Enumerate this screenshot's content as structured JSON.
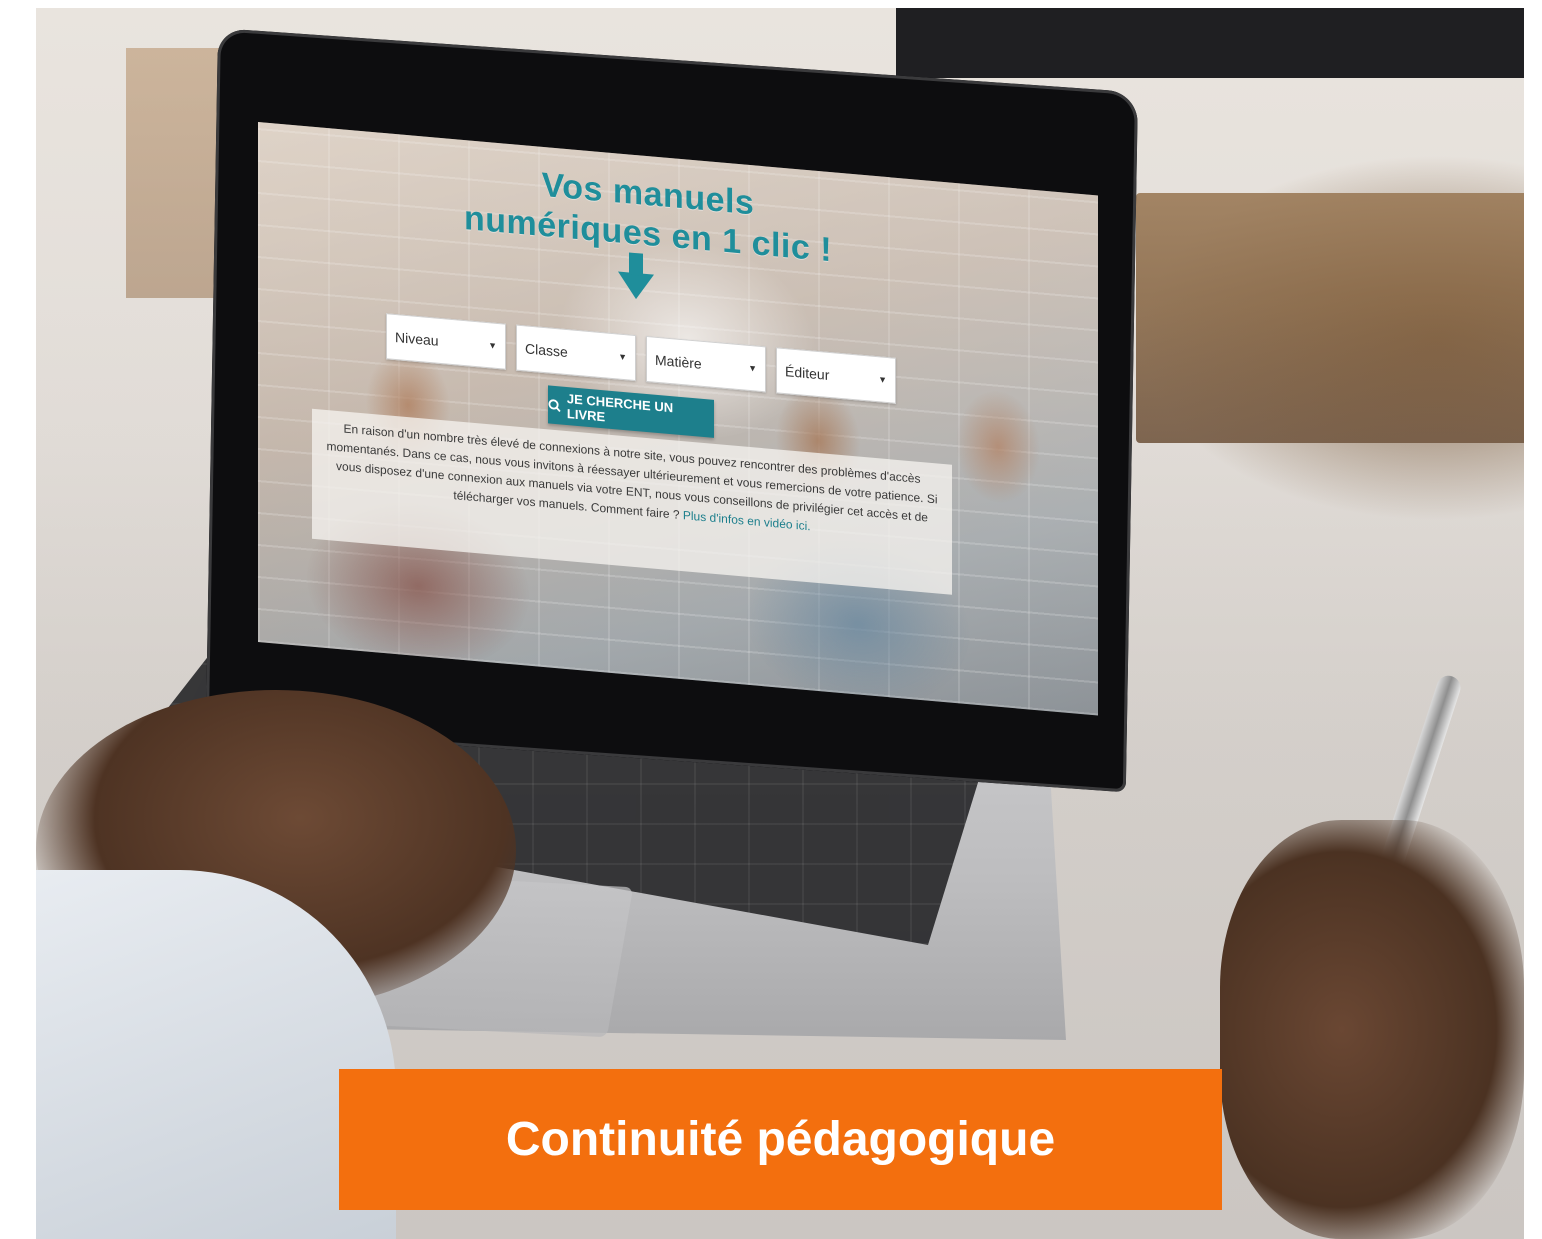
{
  "screen": {
    "headline_line1": "Vos manuels",
    "headline_line2": "numériques en 1 clic !",
    "selects": [
      {
        "label": "Niveau"
      },
      {
        "label": "Classe"
      },
      {
        "label": "Matière"
      },
      {
        "label": "Éditeur"
      }
    ],
    "search_button": "JE CHERCHE UN LIVRE",
    "notice": {
      "text": "En raison d'un nombre très élevé de connexions à notre site, vous pouvez rencontrer des problèmes d'accès momentanés. Dans ce cas, nous vous invitons à réessayer ultérieurement et vous remercions de votre patience. Si vous disposez d'une connexion aux manuels via votre ENT, nous vous conseillons de privilégier cet accès et de télécharger vos manuels. Comment faire ?",
      "link": "Plus d'infos en vidéo ici."
    }
  },
  "banner": {
    "text": "Continuité pédagogique"
  },
  "colors": {
    "accent_teal": "#1f8e9b",
    "button_teal": "#1d7f8c",
    "banner_orange": "#f36f0e"
  },
  "icons": {
    "arrow": "arrow-down-icon",
    "search": "search-icon"
  }
}
